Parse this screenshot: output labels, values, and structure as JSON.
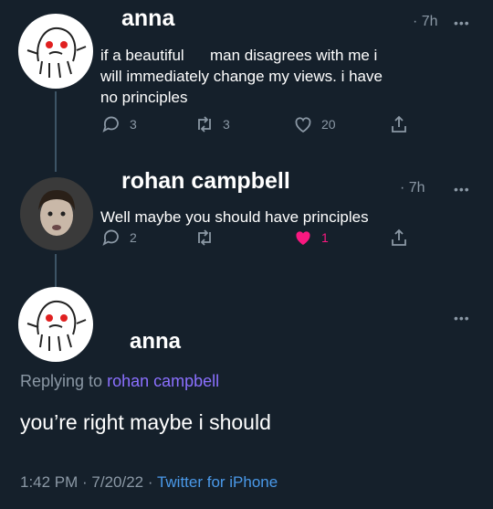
{
  "tweet1": {
    "name": "anna",
    "time": "· 7h",
    "more": "•••",
    "text_line1": "if a beautiful      man disagrees with me i",
    "text_line2": "will immediately change my views. i have",
    "text_line3": "no principles",
    "replies": "3",
    "retweets": "3",
    "likes": "20"
  },
  "tweet2": {
    "name": "rohan campbell",
    "time": "· 7h",
    "more": "•••",
    "text": "Well maybe you should have principles",
    "replies": "2",
    "retweets": "",
    "likes": "1",
    "like_color": "#f91880"
  },
  "tweet3": {
    "name": "anna",
    "more": "•••",
    "replying_prefix": "Replying to",
    "replying_user": "rohan campbell",
    "text": "you’re right maybe i should",
    "timestamp": "1:42 PM · 7/20/22 · ",
    "source": "Twitter for iPhone"
  },
  "colors": {
    "background": "#15202b",
    "secondary_text": "#8b98a5",
    "link": "#4a99e9",
    "mention": "#8b70ff"
  },
  "icons": [
    "reply-icon",
    "retweet-icon",
    "heart-icon",
    "share-icon",
    "more-icon",
    "avatar-drawing",
    "avatar-photo"
  ]
}
